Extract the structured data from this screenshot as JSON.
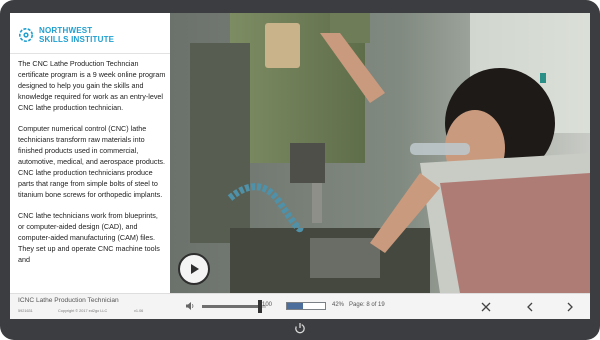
{
  "logo": {
    "line1": "NORTHWEST",
    "line2": "SKILLS INSTITUTE",
    "icon": "cog-logo-icon",
    "color": "#1f9fd0"
  },
  "content": {
    "paragraphs": [
      "The CNC Lathe Production Techncian certificate program is a 9 week online program designed to help you gain the skills and knowledge required for work as an entry-level CNC lathe production technician.",
      "Computer numerical control (CNC) lathe technicians transform raw materials into finished products used in commercial, automotive, medical, and aerospace products. CNC lathe production technicians produce parts that range from simple bolts of steel to titanium bone screws for orthopedic implants.",
      "CNC lathe technicians work from blueprints, or computer-aided design (CAD), and computer-aided manufacturing (CAM) files. They set up and operate CNC machine tools and"
    ]
  },
  "video": {
    "play_icon": "play-icon"
  },
  "footer": {
    "course_title": "ICNC Lathe Production Technician",
    "course_code": "5921631",
    "copyright": "Copyright © 2017 ed2go LLC",
    "version": "v1.06",
    "volume_value": "100",
    "volume_level": 0.9,
    "progress_percent_label": "42%",
    "progress_fraction": 0.42,
    "page_label": "Page: 8 of 19",
    "icons": {
      "volume": "speaker-icon",
      "close": "close-icon",
      "prev": "chevron-left-icon",
      "next": "chevron-right-icon",
      "power": "power-icon"
    }
  },
  "colors": {
    "device_frame": "#3c3d40",
    "brand": "#1f9fd0",
    "progress_fill": "#4c6e9d"
  }
}
